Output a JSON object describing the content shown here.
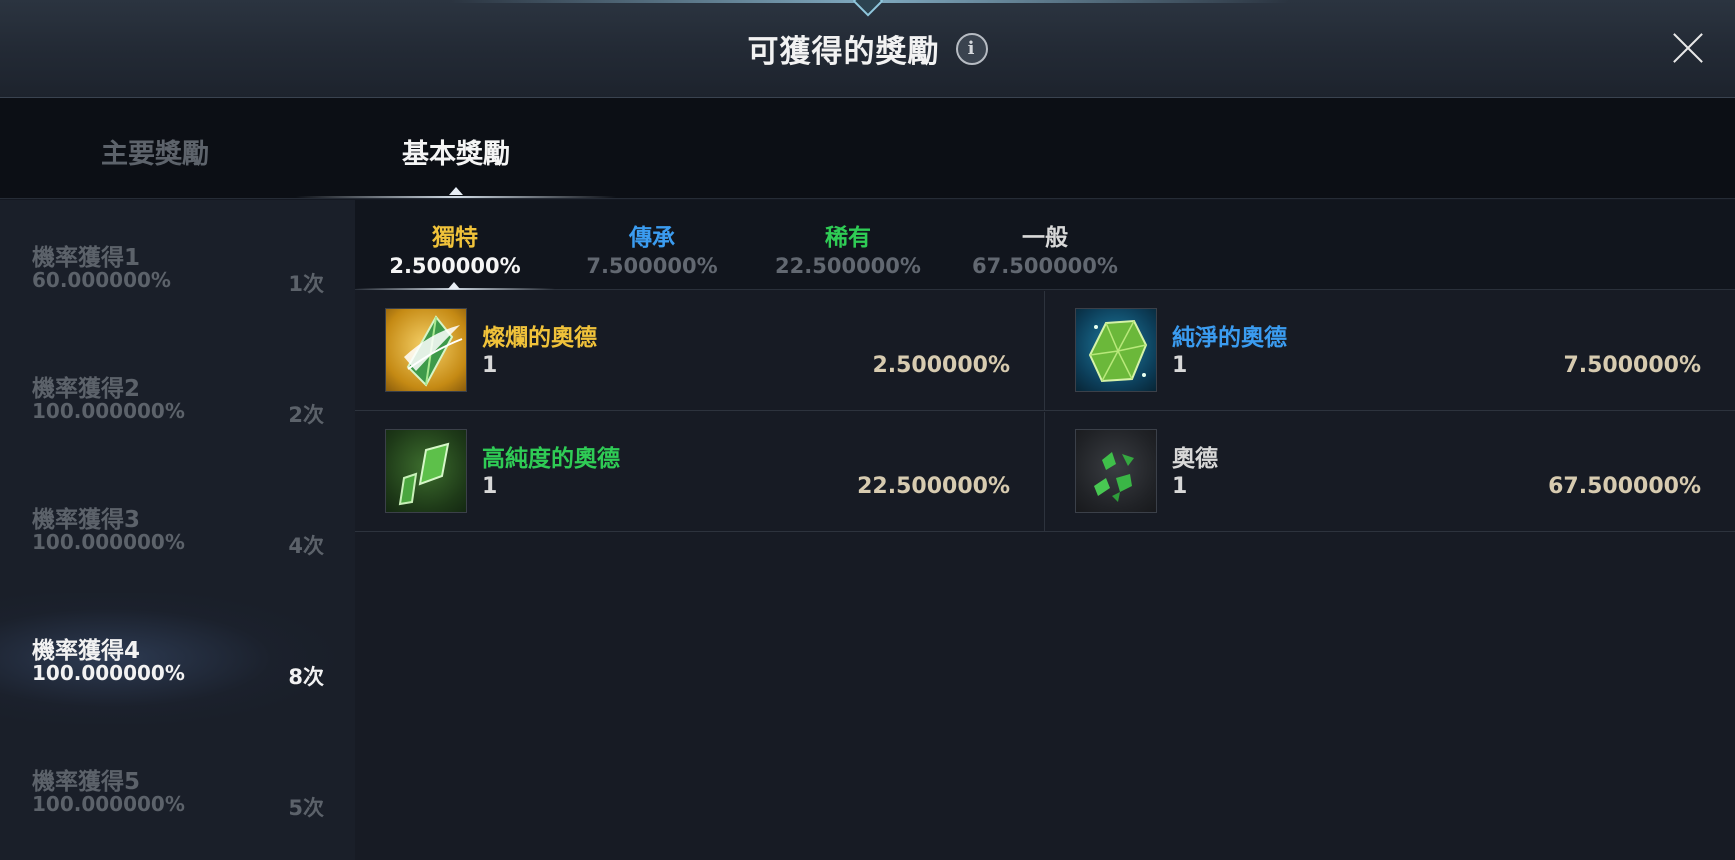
{
  "header": {
    "title": "可獲得的獎勵",
    "info_icon": "info-icon",
    "close_icon": "close-icon"
  },
  "main_tabs": [
    {
      "label": "主要獎勵",
      "active": false
    },
    {
      "label": "基本獎勵",
      "active": true
    }
  ],
  "sidebar": {
    "items": [
      {
        "label": "機率獲得1",
        "prob": "60.000000%",
        "count": "1次",
        "active": false
      },
      {
        "label": "機率獲得2",
        "prob": "100.000000%",
        "count": "2次",
        "active": false
      },
      {
        "label": "機率獲得3",
        "prob": "100.000000%",
        "count": "4次",
        "active": false
      },
      {
        "label": "機率獲得4",
        "prob": "100.000000%",
        "count": "8次",
        "active": true
      },
      {
        "label": "機率獲得5",
        "prob": "100.000000%",
        "count": "5次",
        "active": false
      }
    ]
  },
  "rarity_tabs": [
    {
      "name": "獨特",
      "prob": "2.500000%",
      "color": "#f0c23a",
      "active": true
    },
    {
      "name": "傳承",
      "prob": "7.500000%",
      "color": "#3b9cf0",
      "active": false
    },
    {
      "name": "稀有",
      "prob": "22.500000%",
      "color": "#2fcc55",
      "active": false
    },
    {
      "name": "一般",
      "prob": "67.500000%",
      "color": "#d8d8d8",
      "active": false
    }
  ],
  "rewards": [
    {
      "name": "燦爛的奧德",
      "qty": "1",
      "prob": "2.500000%",
      "name_color": "#f0c23a",
      "icon": "brilliant-ode-gem-icon",
      "frame": "gold"
    },
    {
      "name": "純淨的奧德",
      "qty": "1",
      "prob": "7.500000%",
      "name_color": "#3b9cf0",
      "icon": "pure-ode-gem-icon",
      "frame": "blue"
    },
    {
      "name": "高純度的奧德",
      "qty": "1",
      "prob": "22.500000%",
      "name_color": "#2fcc55",
      "icon": "high-purity-ode-gem-icon",
      "frame": "green"
    },
    {
      "name": "奧德",
      "qty": "1",
      "prob": "67.500000%",
      "name_color": "#d8d8d8",
      "icon": "ode-shards-icon",
      "frame": "gray"
    }
  ]
}
